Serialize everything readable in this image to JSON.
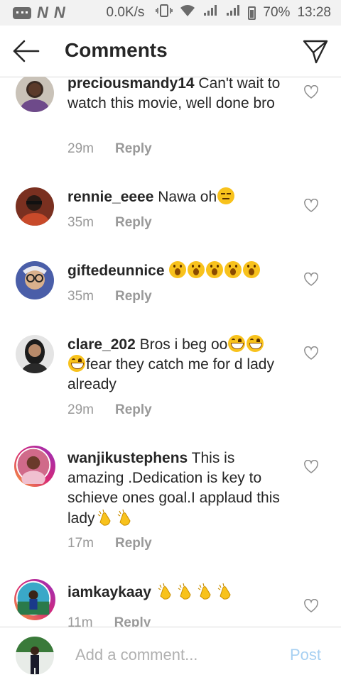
{
  "status_bar": {
    "carrier_icons": [
      "message-icon",
      "n-icon",
      "n-icon"
    ],
    "speed": "0.0K/s",
    "battery": "70%",
    "time": "13:28"
  },
  "header": {
    "title": "Comments",
    "back_icon": "arrow-left-icon",
    "send_icon": "send-icon"
  },
  "comments": [
    {
      "user": "preciousmandy14",
      "text": " Can't wait to watch this movie, well done bro",
      "time": "29m",
      "reply": "Reply"
    },
    {
      "user": "rennie_eeee",
      "text": " Nawa oh",
      "emoji": [
        "pensive"
      ],
      "time": "35m",
      "reply": "Reply"
    },
    {
      "user": "giftedeunnice",
      "text": " ",
      "emoji": [
        "wow",
        "wow",
        "wow",
        "wow",
        "wow"
      ],
      "time": "35m",
      "reply": "Reply"
    },
    {
      "user": "clare_202",
      "text": " Bros i beg oo",
      "emoji_mid": [
        "grin",
        "grin",
        "grin"
      ],
      "text2": "fear they catch me for d lady already",
      "time": "29m",
      "reply": "Reply"
    },
    {
      "user": "wanjikustephens",
      "text": " This is amazing .Dedication is key  to schieve ones goal.I applaud  this lady",
      "emoji": [
        "clap",
        "clap"
      ],
      "time": "17m",
      "reply": "Reply"
    },
    {
      "user": "iamkaykaay",
      "text": " ",
      "emoji": [
        "clap",
        "clap",
        "clap",
        "clap"
      ],
      "time": "11m",
      "reply": "Reply"
    }
  ],
  "composer": {
    "placeholder": "Add a comment...",
    "post_label": "Post"
  },
  "colors": {
    "post_disabled": "#a7d0f2",
    "meta_grey": "#999999",
    "divider": "#dbdbdb"
  }
}
